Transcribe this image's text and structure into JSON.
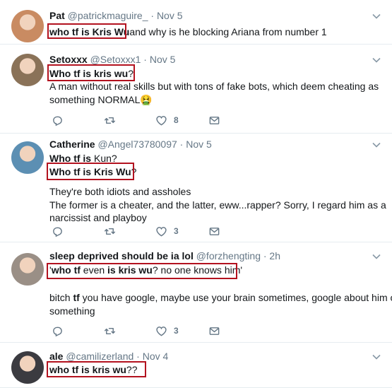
{
  "tweets": [
    {
      "name": "Pat",
      "handle": "@patrickmaguire_",
      "date": "· Nov 5",
      "avatar_color": "#c98b62",
      "lines": [
        {
          "parts": [
            [
              "who tf is Kris Wu",
              "b"
            ],
            [
              "and why is he blocking Ariana from number 1",
              ""
            ]
          ]
        }
      ],
      "likes": ""
    },
    {
      "name": "Setoxxx",
      "handle": "@Setoxxx1",
      "date": "· Nov 5",
      "avatar_color": "#8a7258",
      "lines": [
        {
          "parts": [
            [
              "Who tf is kris wu",
              "b"
            ],
            [
              "?",
              ""
            ]
          ]
        },
        {
          "parts": [
            [
              "A man without real skills but with tons of fake bots, which deem cheating as",
              ""
            ]
          ]
        },
        {
          "parts": [
            [
              "something NORMAL",
              ""
            ],
            [
              "🤮",
              ""
            ]
          ]
        }
      ],
      "likes": "8"
    },
    {
      "name": "Catherine",
      "handle": "@Angel73780097",
      "date": "· Nov 5",
      "avatar_color": "#5c8fb3",
      "lines": [
        {
          "parts": [
            [
              "Who tf is",
              "b"
            ],
            [
              " Kun?",
              ""
            ]
          ]
        },
        {
          "parts": [
            [
              "Who tf is Kris Wu",
              "b"
            ],
            [
              "?",
              ""
            ]
          ]
        },
        {
          "parts": [
            [
              "They're both idiots and assholes",
              ""
            ]
          ]
        },
        {
          "parts": [
            [
              "The former is a cheater, and the latter, eww...rapper? Sorry, I regard him as a",
              ""
            ]
          ]
        },
        {
          "parts": [
            [
              "narcissist and playboy",
              ""
            ]
          ]
        }
      ],
      "likes": "3"
    },
    {
      "name": "sleep deprived should be ia lol",
      "handle": "@forzhengting",
      "date": "· 2h",
      "avatar_color": "#9a8f86",
      "lines": [
        {
          "parts": [
            [
              "'",
              ""
            ],
            [
              "who tf",
              "b"
            ],
            [
              " even ",
              ""
            ],
            [
              "is kris wu",
              "b"
            ],
            [
              "? no one knows him'",
              ""
            ]
          ]
        },
        {
          "parts": [
            [
              "bitch ",
              ""
            ],
            [
              "tf",
              "b"
            ],
            [
              " you have google, maybe use your brain sometimes, google about him or",
              ""
            ]
          ]
        },
        {
          "parts": [
            [
              "something",
              ""
            ]
          ]
        }
      ],
      "likes": "3"
    },
    {
      "name": "ale",
      "handle": "@camilizerland",
      "date": "· Nov 4",
      "avatar_color": "#3b3b40",
      "lines": [
        {
          "parts": [
            [
              "who tf is kris wu",
              "b"
            ],
            [
              "??",
              ""
            ]
          ]
        }
      ],
      "likes": ""
    }
  ],
  "colors": {
    "highlight_box": "#b3121f",
    "muted": "#657786",
    "divider": "#e6ecf0"
  }
}
